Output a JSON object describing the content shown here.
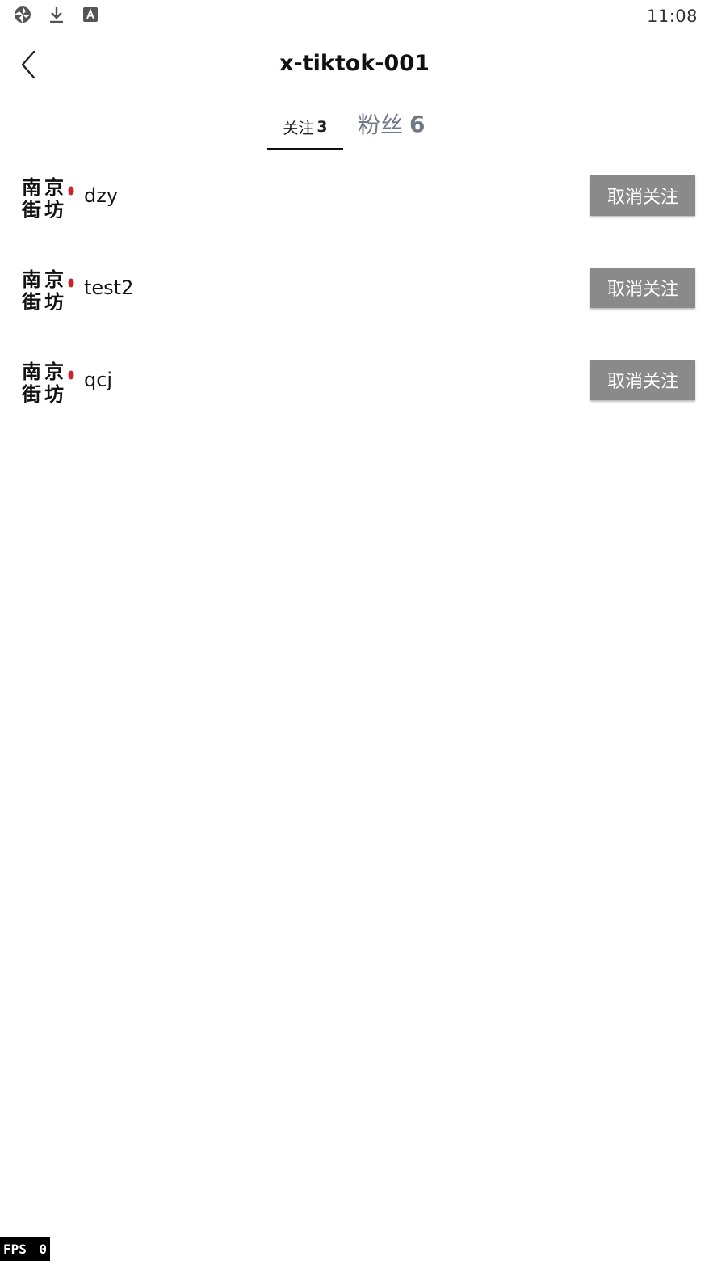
{
  "status_bar": {
    "time": "11:08",
    "icons": [
      "sync-icon",
      "download-icon",
      "keyboard-a-icon"
    ]
  },
  "header": {
    "back_icon": "chevron-left-icon",
    "title": "x-tiktok-001"
  },
  "tabs": [
    {
      "label": "关注",
      "count": "3",
      "active": true
    },
    {
      "label": "粉丝",
      "count": "6",
      "active": false
    }
  ],
  "follow_list": [
    {
      "username": "dzy",
      "button_label": "取消关注",
      "avatar_text": [
        "南",
        "京",
        "街",
        "坊"
      ]
    },
    {
      "username": "test2",
      "button_label": "取消关注",
      "avatar_text": [
        "南",
        "京",
        "街",
        "坊"
      ]
    },
    {
      "username": "qcj",
      "button_label": "取消关注",
      "avatar_text": [
        "南",
        "京",
        "街",
        "坊"
      ]
    }
  ],
  "fps": {
    "label": "FPS",
    "value": "0"
  },
  "colors": {
    "button_bg": "#8a8a8a",
    "tab_inactive": "#707785",
    "avatar_seal": "#d0202a"
  }
}
